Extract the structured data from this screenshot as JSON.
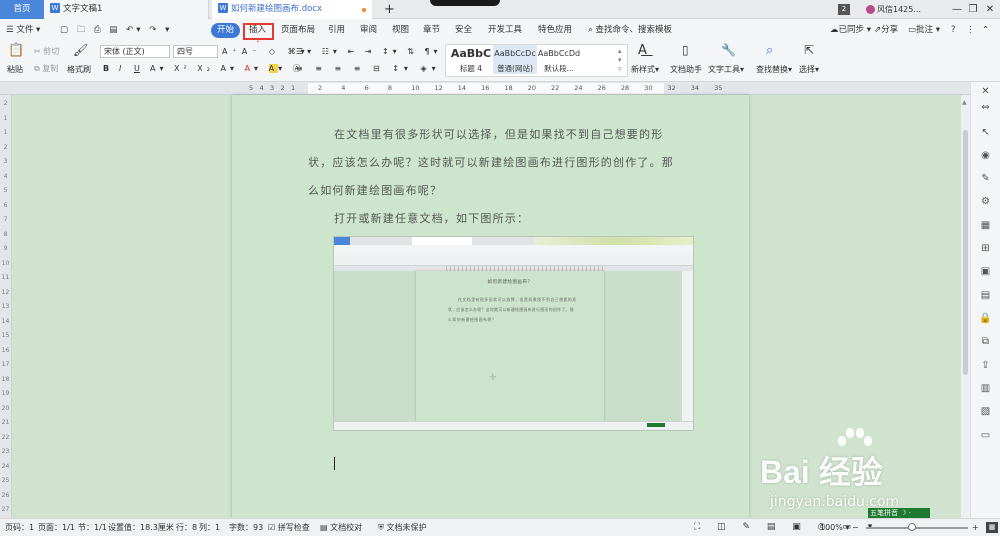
{
  "tabs": {
    "home": "首页",
    "doc1": "文字文稿1",
    "doc2": "如何新建绘图画布.docx",
    "doc_icon": "W",
    "badge": "2",
    "user": "风信1425..."
  },
  "menu": {
    "file": "文件",
    "items": [
      "开始",
      "插入",
      "页面布局",
      "引用",
      "审阅",
      "视图",
      "章节",
      "安全",
      "开发工具",
      "特色应用"
    ],
    "search": "查找命令、搜索模板",
    "sync": "已同步",
    "share": "分享",
    "annotate": "批注"
  },
  "ribbon": {
    "paste": "粘贴",
    "cut": "剪切",
    "copy": "复制",
    "format_painter": "格式刷",
    "font_name": "宋体 (正文)",
    "font_size": "四号",
    "bold": "B",
    "italic": "I",
    "underline": "U",
    "styles": [
      {
        "preview": "AaBbC",
        "label": "标题 4"
      },
      {
        "preview": "AaBbCcDc",
        "label": "普通(网站)"
      },
      {
        "preview": "AaBbCcDd",
        "label": "默认段..."
      }
    ],
    "new_style": "新样式",
    "doc_assistant": "文档助手",
    "text_tools": "文字工具",
    "find_replace": "查找替换",
    "select": "选择"
  },
  "ruler": {
    "numbers": [
      "5",
      "4",
      "3",
      "2",
      "1",
      "2",
      "4",
      "6",
      "8",
      "10",
      "12",
      "14",
      "16",
      "18",
      "20",
      "22",
      "24",
      "26",
      "28",
      "30",
      "32",
      "34",
      "35"
    ]
  },
  "document": {
    "paragraph1_line1": "在文档里有很多形状可以选择，但是如果找不到自己想要的形",
    "paragraph1_line2": "状，应该怎么办呢？这时就可以新建绘图画布进行图形的创作了。那",
    "paragraph1_line3": "么如何新建绘图画布呢？",
    "paragraph2": "打开或新建任意文档，如下图所示：",
    "embedded": {
      "title": "如何新建绘图画布？",
      "line1": "在文档里有很多形状可以选择，但是如果找不到自己想要的形",
      "line2": "状，应该怎么办呢？这时就可以新建绘图画布进行图形的创作了。那",
      "line3": "么如何新建绘图画布呢？"
    }
  },
  "status": {
    "page": "页码：1",
    "pages": "页面：1/1",
    "section": "节：1/1",
    "setting": "设置值：18.3厘米",
    "row": "行：8",
    "col": "列：1",
    "words": "字数：93",
    "spell": "拼写检查",
    "proof": "文档校对",
    "protect": "文档未保护",
    "zoom": "100%"
  },
  "ime": "五笔拼音",
  "watermark": {
    "brand": "Bai 经验",
    "url": "jingyan.baidu.com"
  },
  "colors": {
    "accent": "#3b78d8",
    "page_bg": "#cde5cd",
    "highlight_box": "#e53935",
    "arrow": "#e53935"
  }
}
